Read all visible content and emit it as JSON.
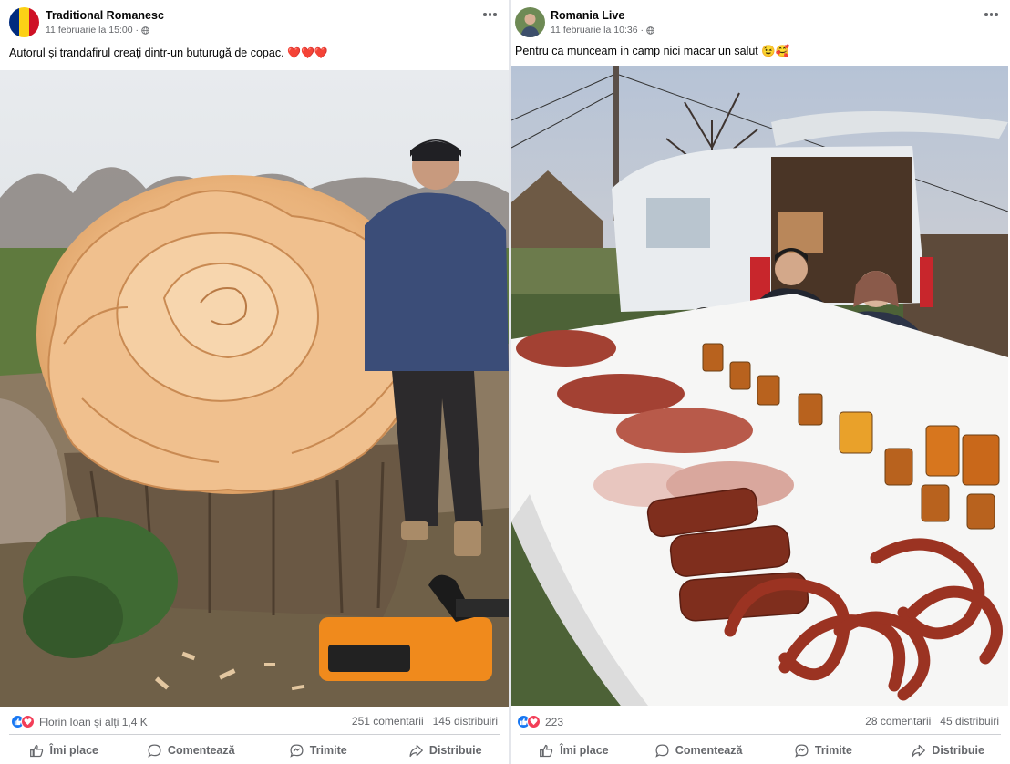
{
  "posts": [
    {
      "author": "Traditional Romanesc",
      "time": "11 februarie la 15:00",
      "caption": "Autorul și trandafirul creați dintr-un buturugă de copac.",
      "hearts": "❤️❤️❤️",
      "reactions": "Florin Ioan și alți 1,4 K",
      "comments": "251 comentarii",
      "shares": "145 distribuiri",
      "actions": {
        "like": "Îmi place",
        "comment": "Comentează",
        "send": "Trimite",
        "share": "Distribuie"
      }
    },
    {
      "author": "Romania Live",
      "time": "11 februarie la 10:36",
      "caption": "Pentru ca munceam in camp nici macar un salut 😉🥰",
      "reactions": "223",
      "comments": "28 comentarii",
      "shares": "45 distribuiri",
      "actions": {
        "like": "Îmi place",
        "comment": "Comentează",
        "send": "Trimite",
        "share": "Distribuie"
      }
    }
  ],
  "colors": {
    "like_blue": "#1877f2",
    "love_red": "#f33e58",
    "meta_grey": "#65676b",
    "divider": "#e4e6eb"
  },
  "icons": [
    "globe-icon",
    "more-options-icon",
    "like-icon",
    "comment-icon",
    "send-icon",
    "share-icon",
    "like-reaction-icon",
    "love-reaction-icon"
  ]
}
